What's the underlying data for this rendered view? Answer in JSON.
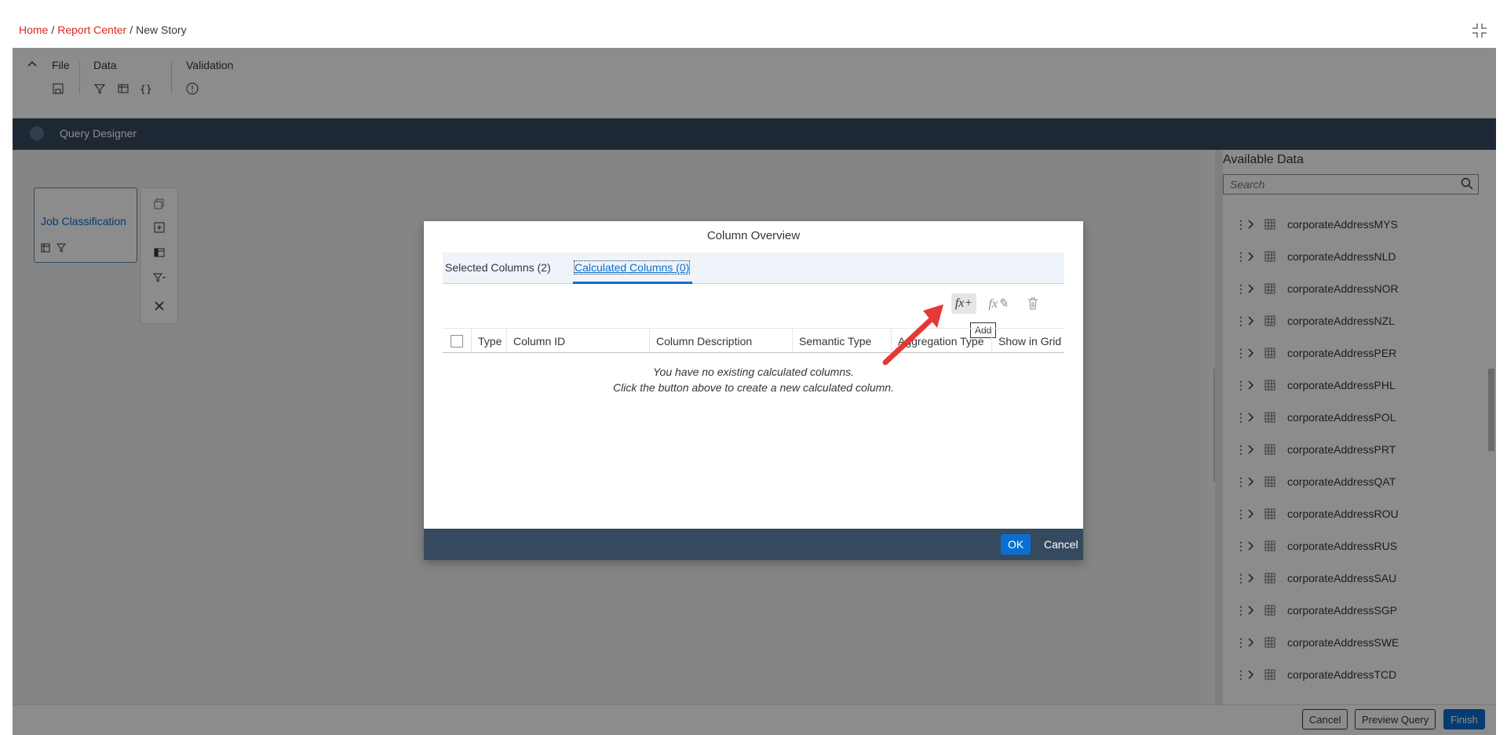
{
  "breadcrumb": {
    "home": "Home",
    "report_center": "Report Center",
    "current": "New Story",
    "separator": "/"
  },
  "toolbar": {
    "file": "File",
    "data": "Data",
    "validation": "Validation"
  },
  "query_designer": {
    "title": "Query Designer"
  },
  "node": {
    "name": "Job Classification"
  },
  "available_data": {
    "title": "Available Data",
    "search_placeholder": "Search",
    "items": [
      "corporateAddressMYS",
      "corporateAddressNLD",
      "corporateAddressNOR",
      "corporateAddressNZL",
      "corporateAddressPER",
      "corporateAddressPHL",
      "corporateAddressPOL",
      "corporateAddressPRT",
      "corporateAddressQAT",
      "corporateAddressROU",
      "corporateAddressRUS",
      "corporateAddressSAU",
      "corporateAddressSGP",
      "corporateAddressSWE",
      "corporateAddressTCD"
    ]
  },
  "footer": {
    "cancel": "Cancel",
    "preview_query": "Preview Query",
    "finish": "Finish"
  },
  "dialog": {
    "title": "Column Overview",
    "tabs": [
      {
        "label": "Selected Columns (2)"
      },
      {
        "label": "Calculated Columns (0)"
      }
    ],
    "active_tab": "Calculated Columns (0)",
    "action_add": "fx+",
    "action_edit": "fx✎",
    "tooltip": "Add",
    "columns": [
      "Type",
      "Column ID",
      "Column Description",
      "Semantic Type",
      "Aggregation Type",
      "Show in Grid"
    ],
    "empty_line1": "You have no existing calculated columns.",
    "empty_line2": "Click the button above to create a new calculated column.",
    "ok": "OK",
    "cancel": "Cancel"
  },
  "colors": {
    "brand_red": "#d9261c",
    "header_dark": "#354a5f",
    "accent_blue": "#0a6ed1",
    "arrow_red": "#e53935"
  }
}
